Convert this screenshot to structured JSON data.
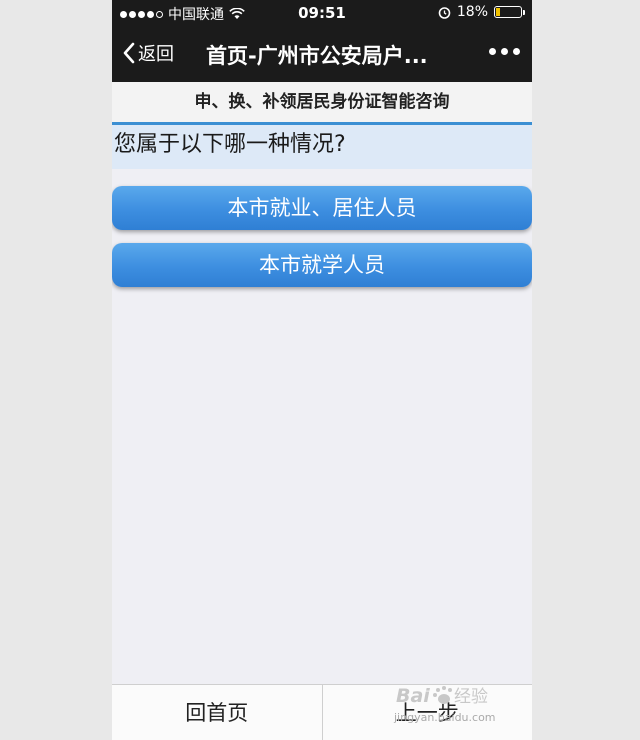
{
  "status_bar": {
    "carrier": "中国联通",
    "time": "09:51",
    "battery": "18%",
    "battery_level": 0.18,
    "icons": [
      "signal-dots-icon",
      "wifi-icon",
      "alarm-icon",
      "battery-icon"
    ]
  },
  "nav": {
    "back_label": "返回",
    "title": "首页-广州市公安局户...",
    "more_icon": "more-dots-icon"
  },
  "subheader": "申、换、补领居民身份证智能咨询",
  "question": "您属于以下哪一种情况?",
  "options": [
    {
      "label": "本市就业、居住人员"
    },
    {
      "label": "本市就学人员"
    }
  ],
  "bottom_bar": {
    "home_label": "回首页",
    "prev_label": "上一步"
  },
  "colors": {
    "accent": "#3d8ee0",
    "question_bg": "#dde9f7",
    "nav_bg": "#1b1b1b"
  },
  "watermark": {
    "brand": "Bai du 经验",
    "url": "jingyan.baidu.com"
  }
}
